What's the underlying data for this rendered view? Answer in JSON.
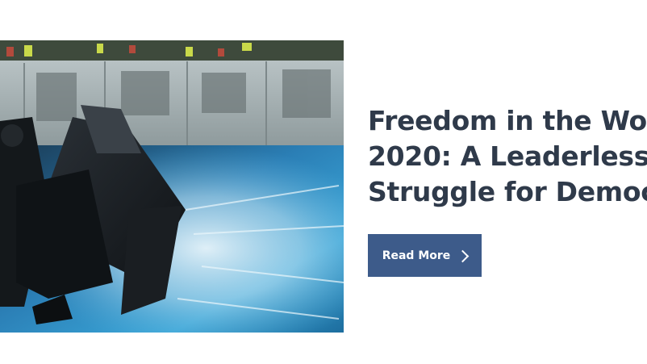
{
  "feature": {
    "image": {
      "name": "protest-photo",
      "description_icon": "protesters-umbrellas-water-cannon-image"
    },
    "headline_lines": [
      "Freedom in the Wor",
      "2020: A Leaderless",
      "Struggle for Democ"
    ],
    "cta": {
      "label": "Read More",
      "icon": "chevron-right-icon"
    }
  },
  "colors": {
    "headline": "#2f3a4a",
    "button_bg": "#3d5b8a",
    "button_text": "#ffffff"
  }
}
